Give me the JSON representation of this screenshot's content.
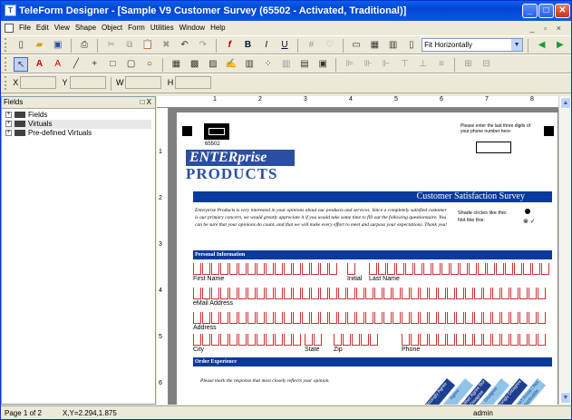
{
  "window": {
    "title": "TeleForm Designer - [Sample V9 Customer Survey (65502 - Activated, Traditional)]"
  },
  "menu": [
    "File",
    "Edit",
    "View",
    "Shape",
    "Object",
    "Form",
    "Utilities",
    "Window",
    "Help"
  ],
  "toolbar": {
    "zoom_value": "Fit Horizontally"
  },
  "coords": {
    "x_label": "X",
    "y_label": "Y",
    "w_label": "W",
    "h_label": "H"
  },
  "panel": {
    "title": "Fields",
    "close": "□ X",
    "tree": [
      {
        "label": "Fields",
        "expand": "+"
      },
      {
        "label": "Virtuals",
        "expand": "+"
      },
      {
        "label": "Pre-defined Virtuals",
        "expand": "+"
      }
    ]
  },
  "ruler": {
    "h": [
      "1",
      "2",
      "3",
      "4",
      "5",
      "6",
      "7",
      "8"
    ],
    "v": [
      "1",
      "2",
      "3",
      "4",
      "5",
      "6"
    ]
  },
  "form": {
    "form_id": "65502",
    "logo_top": "ENTERprise",
    "logo_bottom": "PRODUCTS",
    "top_right_note": "Please enter the last three digits of your phone number here:",
    "survey_title": "Customer Satisfaction Survey",
    "intro": "Enterprise Products is very interested in your opinions about our products and services. Since a completely satisfied customer is our primary concern, we would greatly appreciate it if you would take some time to fill out the following questionnaire. You can be sure that your opinions do count, and that we will make every effort to meet and surpass your expectations. Thank you!",
    "shade_like": "Shade circles like this:",
    "not_like": "Not like this:",
    "section_personal": "Personal Information",
    "first_name": "First Name",
    "initial": "Initial",
    "last_name": "Last Name",
    "email": "eMail Address",
    "address": "Address",
    "city": "City",
    "state": "State",
    "zip": "Zip",
    "phone": "Phone",
    "section_order": "Order Experience",
    "order_instr": "Please mark the response that most closely reflects your opinion.",
    "ratings": [
      "Strongly Agree",
      "Agree",
      "Neither Agree Nor Disagree",
      "Disagree",
      "Strongly Disagree",
      "Don't Know / Not Applicable"
    ]
  },
  "status": {
    "page": "Page 1 of 2",
    "xy": "X,Y=2.294,1.875",
    "user": "admin"
  }
}
